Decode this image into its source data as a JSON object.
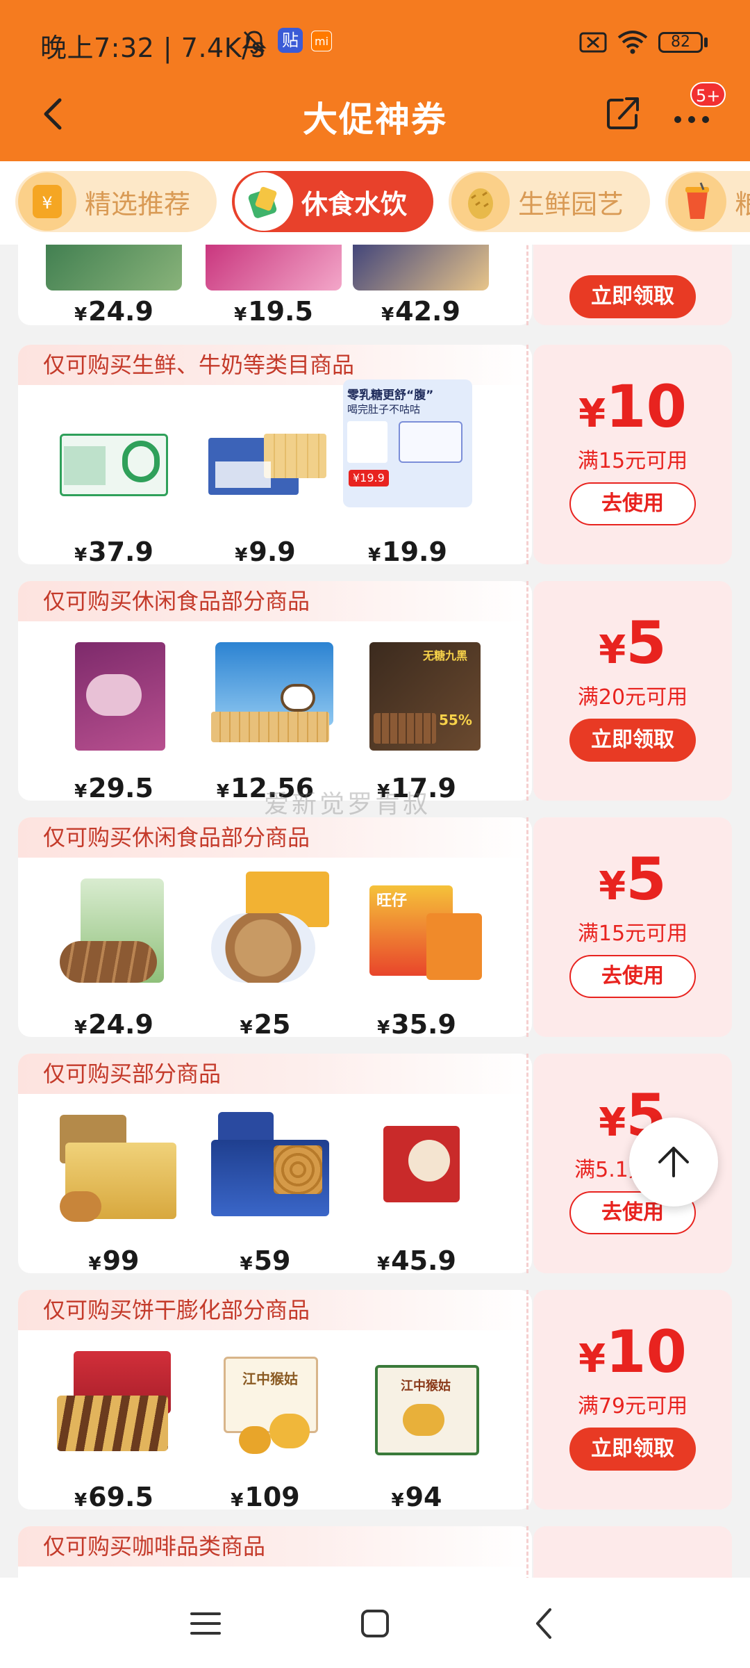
{
  "status_bar": {
    "time": "晚上7:32 | 7.4K/s",
    "battery": "82",
    "app_badge_text": "贴",
    "mi_text": "mi"
  },
  "header": {
    "title": "大促神券",
    "more_badge": "5+",
    "colors": {
      "primary": "#f57b1f",
      "accent": "#e8231f"
    }
  },
  "tabs": [
    {
      "label": "精选推荐",
      "icon": "coupon-icon",
      "active": false
    },
    {
      "label": "休食水饮",
      "icon": "snack-icon",
      "active": true
    },
    {
      "label": "生鲜园艺",
      "icon": "durian-icon",
      "active": false
    },
    {
      "label": "粮",
      "icon": "drink-icon",
      "active": false
    }
  ],
  "coupons": [
    {
      "condition": "",
      "products": [
        {
          "price": "24.9"
        },
        {
          "price": "19.5"
        },
        {
          "price": "42.9"
        }
      ],
      "amount": "",
      "threshold": "",
      "action": "立即领取"
    },
    {
      "condition": "仅可购买生鲜、牛奶等类目商品",
      "products": [
        {
          "price": "37.9"
        },
        {
          "price": "9.9"
        },
        {
          "price": "19.9"
        }
      ],
      "amount": "10",
      "threshold": "满15元可用",
      "action": "去使用",
      "promo_text": {
        "line1": "零乳糖更舒“腹”",
        "line2": "喝完肚子不咕咕",
        "price_tag": "¥19.9"
      }
    },
    {
      "condition": "仅可购买休闲食品部分商品",
      "products": [
        {
          "price": "29.5"
        },
        {
          "price": "12.56"
        },
        {
          "price": "17.9"
        }
      ],
      "amount": "5",
      "threshold": "满20元可用",
      "action": "立即领取",
      "pack_text": {
        "sugar_free": "无糖九黑",
        "percent": "55%"
      }
    },
    {
      "condition": "仅可购买休闲食品部分商品",
      "products": [
        {
          "price": "24.9"
        },
        {
          "price": "25"
        },
        {
          "price": "35.9"
        }
      ],
      "amount": "5",
      "threshold": "满15元可用",
      "action": "去使用",
      "pack_text": {
        "brand": "旺仔"
      }
    },
    {
      "condition": "仅可购买部分商品",
      "products": [
        {
          "price": "99"
        },
        {
          "price": "59"
        },
        {
          "price": "45.9"
        }
      ],
      "amount": "5",
      "threshold": "满5.1元可用",
      "action": "去使用"
    },
    {
      "condition": "仅可购买饼干膨化部分商品",
      "products": [
        {
          "price": "69.5"
        },
        {
          "price": "109"
        },
        {
          "price": "94"
        }
      ],
      "amount": "10",
      "threshold": "满79元可用",
      "action": "立即领取",
      "pack_text": {
        "brand": "江中猴姑"
      }
    },
    {
      "condition": "仅可购买咖啡品类商品",
      "products": [],
      "amount": "",
      "threshold": "",
      "action": ""
    }
  ],
  "currency_symbol": "¥",
  "watermark": "爱新觉罗肯叔",
  "nav": {
    "menu_icon": "menu-icon",
    "home_icon": "home-icon",
    "back_icon": "back-icon"
  }
}
